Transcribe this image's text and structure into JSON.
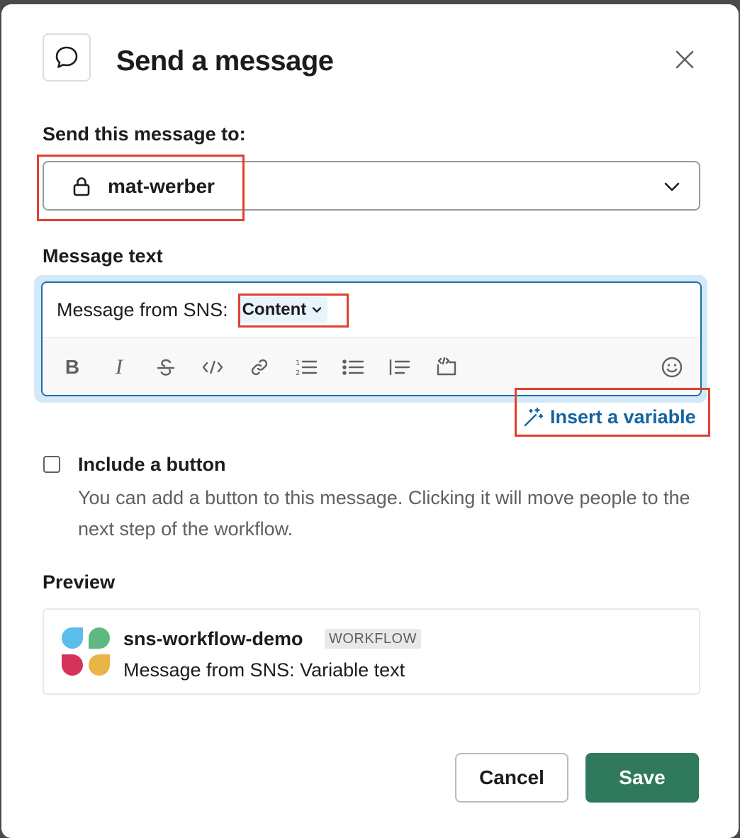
{
  "dialog": {
    "title": "Send a message"
  },
  "recipient": {
    "label": "Send this message to:",
    "value": "mat-werber"
  },
  "message": {
    "label": "Message text",
    "prefix": "Message from SNS:",
    "variable_chip": "Content",
    "insert_variable_label": "Insert a variable"
  },
  "toolbar": {
    "items": [
      "bold-icon",
      "italic-icon",
      "strikethrough-icon",
      "code-icon",
      "link-icon",
      "ordered-list-icon",
      "bulleted-list-icon",
      "blockquote-icon",
      "code-block-icon",
      "emoji-icon"
    ]
  },
  "include_button": {
    "checked": false,
    "label": "Include a button",
    "description": "You can add a button to this message. Clicking it will move people to the next step of the workflow."
  },
  "preview": {
    "label": "Preview",
    "app_name": "sns-workflow-demo",
    "badge": "WORKFLOW",
    "message": "Message from SNS: Variable text",
    "logo_colors": [
      "#5bbde9",
      "#5eb882",
      "#d6335b",
      "#e9b547"
    ]
  },
  "footer": {
    "cancel_label": "Cancel",
    "save_label": "Save"
  },
  "colors": {
    "primary_green": "#2f7a5c",
    "link_blue": "#1264a3",
    "focus_border": "#1d6ea9",
    "highlight_red": "#e0412e"
  }
}
